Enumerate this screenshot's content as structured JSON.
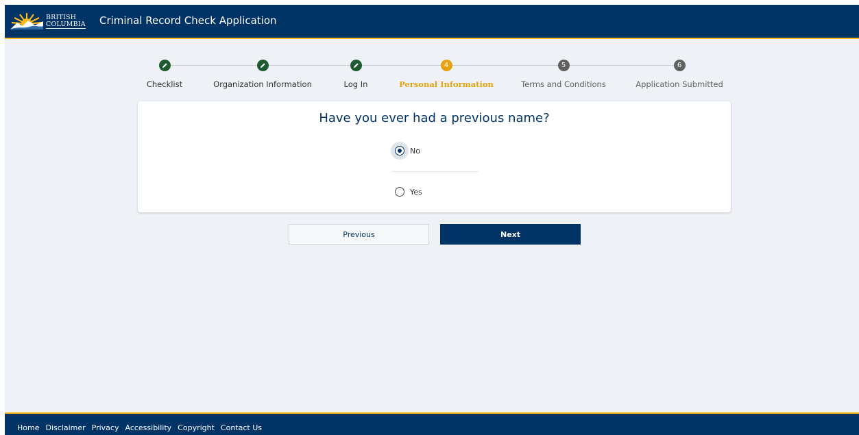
{
  "header": {
    "logo_line1": "BRITISH",
    "logo_line2": "COLUMBIA",
    "app_title": "Criminal Record Check Application"
  },
  "stepper": {
    "steps": [
      {
        "label": "Checklist",
        "status": "done",
        "marker": "pencil-icon"
      },
      {
        "label": "Organization Information",
        "status": "done",
        "marker": "pencil-icon"
      },
      {
        "label": "Log In",
        "status": "done",
        "marker": "pencil-icon"
      },
      {
        "label": "Personal Information",
        "status": "active",
        "marker": "4"
      },
      {
        "label": "Terms and Conditions",
        "status": "todo",
        "marker": "5"
      },
      {
        "label": "Application Submitted",
        "status": "todo",
        "marker": "6"
      }
    ]
  },
  "form": {
    "question": "Have you ever had a previous name?",
    "options": [
      {
        "label": "No",
        "checked": true
      },
      {
        "label": "Yes",
        "checked": false
      }
    ]
  },
  "buttons": {
    "previous_label": "Previous",
    "next_label": "Next"
  },
  "footer": {
    "links": [
      "Home",
      "Disclaimer",
      "Privacy",
      "Accessibility",
      "Copyright",
      "Contact Us"
    ]
  },
  "colors": {
    "brand_blue": "#003366",
    "brand_gold": "#fcba19",
    "step_done": "#1d5a2f",
    "step_active": "#e6a20f",
    "step_todo": "#606060"
  }
}
